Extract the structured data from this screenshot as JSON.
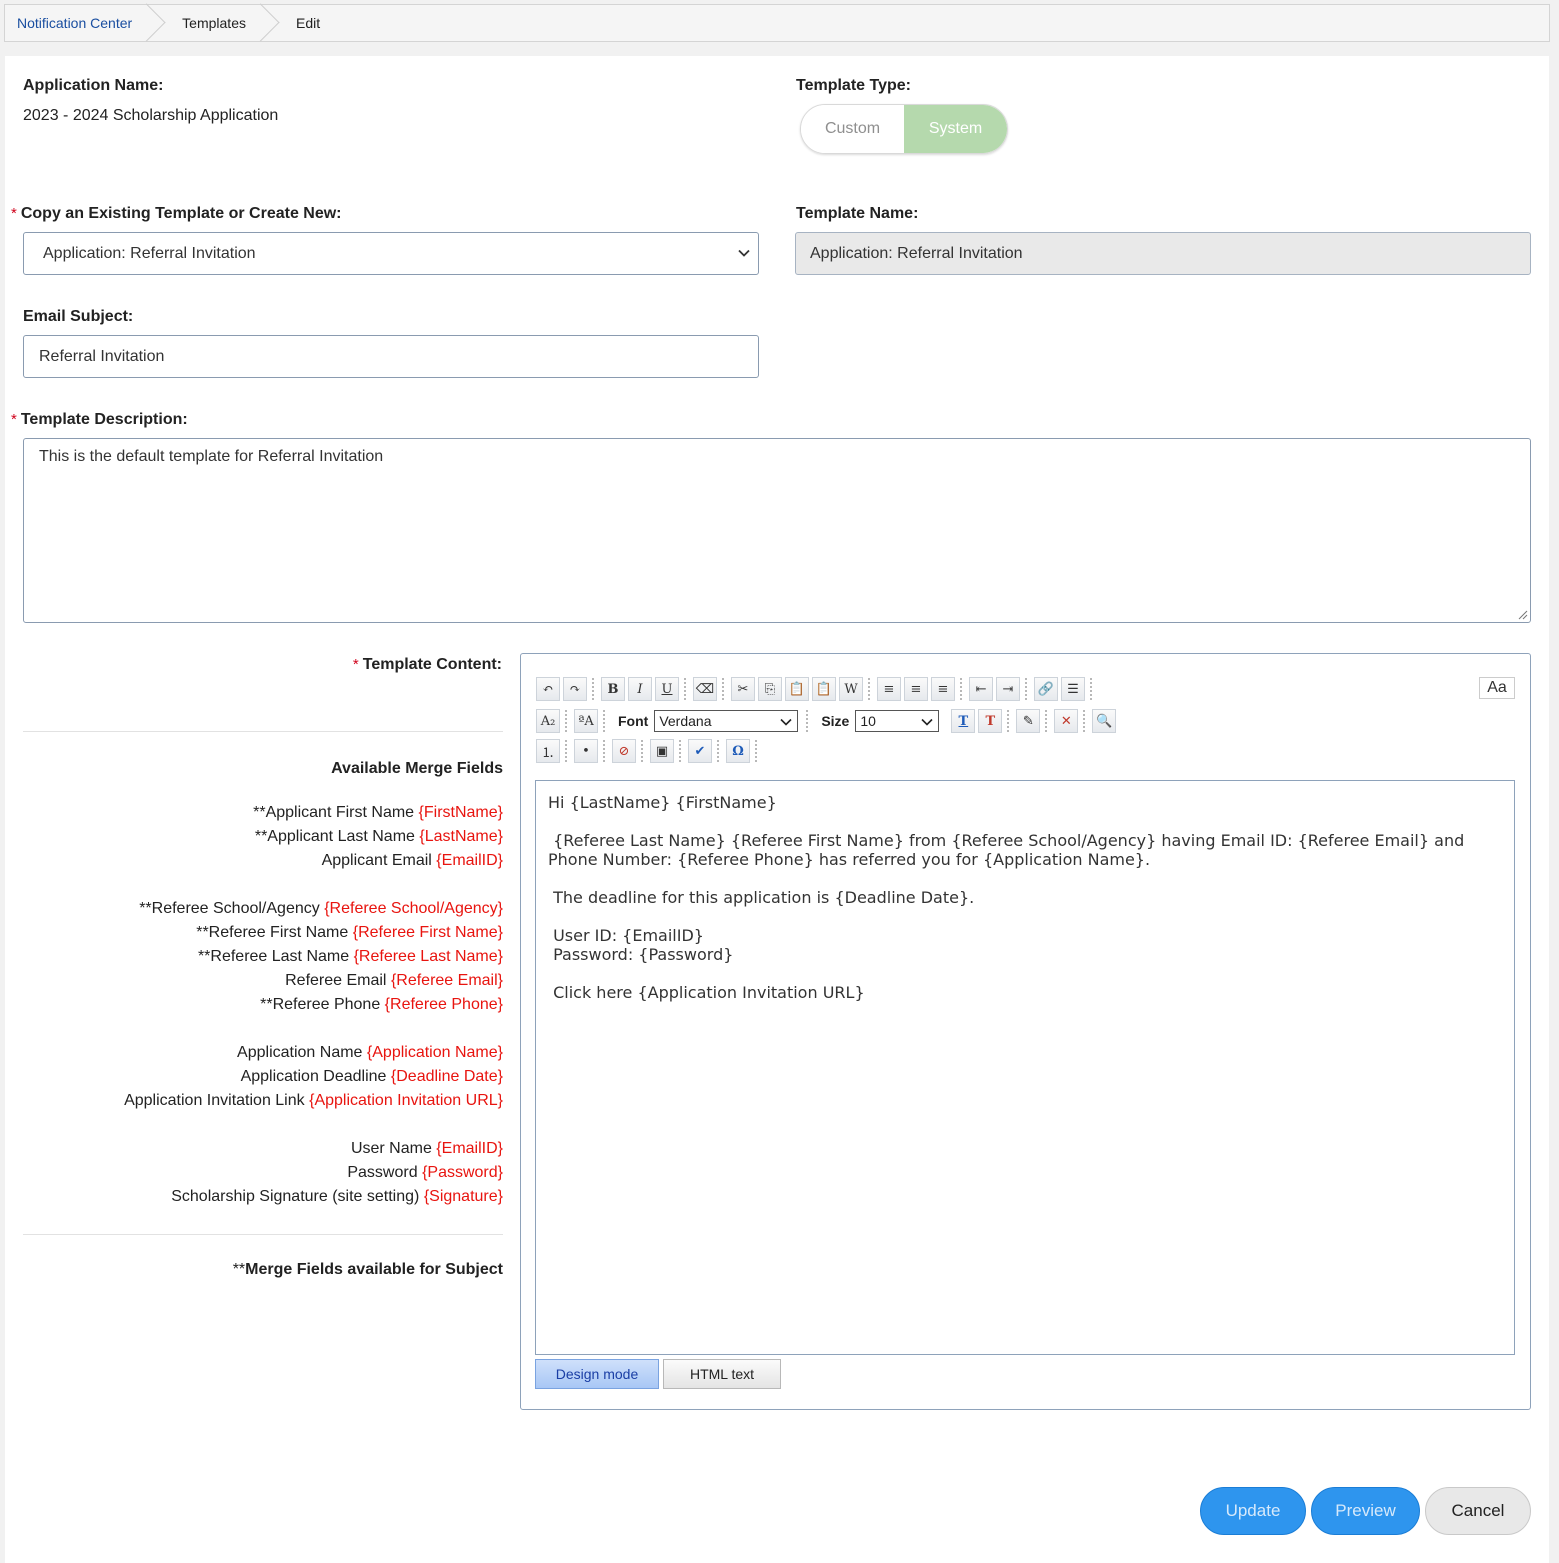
{
  "breadcrumb": {
    "items": [
      "Notification Center",
      "Templates",
      "Edit"
    ]
  },
  "form": {
    "app_name_label": "Application Name:",
    "app_name_value": "2023 - 2024 Scholarship Application",
    "template_type_label": "Template Type:",
    "template_type_options": [
      "Custom",
      "System"
    ],
    "template_type_selected": "System",
    "copy_label": "Copy an Existing Template or Create New:",
    "copy_value": "Application: Referral Invitation",
    "template_name_label": "Template Name:",
    "template_name_value": "Application: Referral Invitation",
    "subject_label": "Email Subject:",
    "subject_value": "Referral Invitation",
    "description_label": "Template Description:",
    "description_value": "This is the default template for Referral Invitation",
    "content_label": "Template Content:",
    "required_mark": "*"
  },
  "merge": {
    "title": "Available Merge Fields",
    "fields": [
      {
        "label": "**Applicant First Name",
        "token": "{FirstName}"
      },
      {
        "label": "**Applicant Last Name",
        "token": "{LastName}"
      },
      {
        "label": "Applicant Email",
        "token": "{EmailID}"
      },
      {
        "label": "**Referee School/Agency",
        "token": "{Referee School/Agency}"
      },
      {
        "label": "**Referee First Name",
        "token": "{Referee First Name}"
      },
      {
        "label": "**Referee Last Name",
        "token": "{Referee Last Name}"
      },
      {
        "label": "Referee Email",
        "token": "{Referee Email}"
      },
      {
        "label": "**Referee Phone",
        "token": "{Referee Phone}"
      },
      {
        "label": "Application Name",
        "token": "{Application Name}"
      },
      {
        "label": "Application Deadline",
        "token": "{Deadline Date}"
      },
      {
        "label": "Application Invitation Link",
        "token": "{Application Invitation URL}"
      },
      {
        "label": "User Name",
        "token": "{EmailID}"
      },
      {
        "label": "Password",
        "token": "{Password}"
      },
      {
        "label": "Scholarship Signature (site setting)",
        "token": "{Signature}"
      }
    ],
    "footnote_prefix": "**",
    "footnote": "Merge Fields available for Subject"
  },
  "editor": {
    "font_label": "Font",
    "font_value": "Verdana",
    "size_label": "Size",
    "size_value": "10",
    "aa_label": "Aa",
    "lines": [
      "Hi {LastName} {FirstName}",
      " {Referee Last Name} {Referee First Name} from {Referee School/Agency} having Email ID: {Referee Email} and\nPhone Number: {Referee Phone} has referred you for {Application Name}.",
      " The deadline for this application is {Deadline Date}.",
      " User ID: {EmailID}\n Password: {Password}",
      " Click here {Application Invitation URL}"
    ],
    "mode_design": "Design mode",
    "mode_html": "HTML text"
  },
  "buttons": {
    "update": "Update",
    "preview": "Preview",
    "cancel": "Cancel"
  },
  "colors": {
    "accent": "#2e95ee",
    "token": "#e8140f",
    "toggle_on": "#b5d9ad",
    "link": "#1a4ea0"
  }
}
